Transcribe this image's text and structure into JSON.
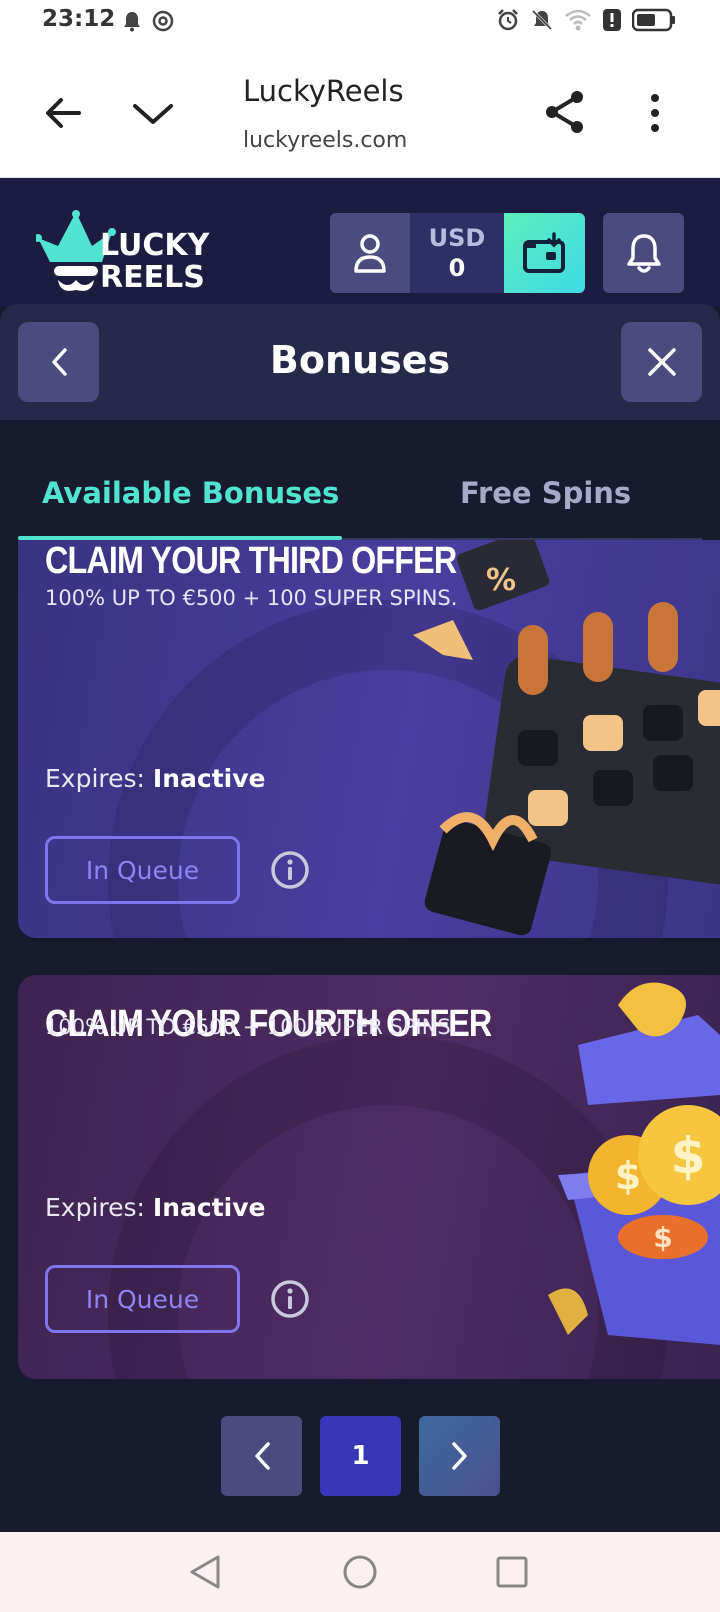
{
  "status_bar": {
    "time": "23:12"
  },
  "browser": {
    "site_title": "LuckyReels",
    "site_url": "luckyreels.com"
  },
  "header": {
    "logo_line1": "LUCKY",
    "logo_line2": "REELS",
    "currency": "USD",
    "balance": "0"
  },
  "modal": {
    "title": "Bonuses",
    "tabs": [
      {
        "label": "Available Bonuses",
        "active": true
      },
      {
        "label": "Free Spins",
        "active": false
      }
    ]
  },
  "bonuses": [
    {
      "title": "CLAIM YOUR THIRD OFFER",
      "subtitle": "100% UP TO €500 + 100 SUPER SPINS.",
      "expires_label": "Expires:",
      "expires_value": "Inactive",
      "button_label": "In Queue"
    },
    {
      "title": "CLAIM YOUR FOURTH OFFER",
      "subtitle": "100% UP TO €500 + 100 SUPER SPINS.",
      "expires_label": "Expires:",
      "expires_value": "Inactive",
      "button_label": "In Queue"
    }
  ],
  "pagination": {
    "current_page": "1"
  },
  "colors": {
    "accent": "#4fe3d0",
    "button_outline": "#7f75ec",
    "header_bg": "#1c1c40",
    "page_active": "#3a36b8"
  }
}
